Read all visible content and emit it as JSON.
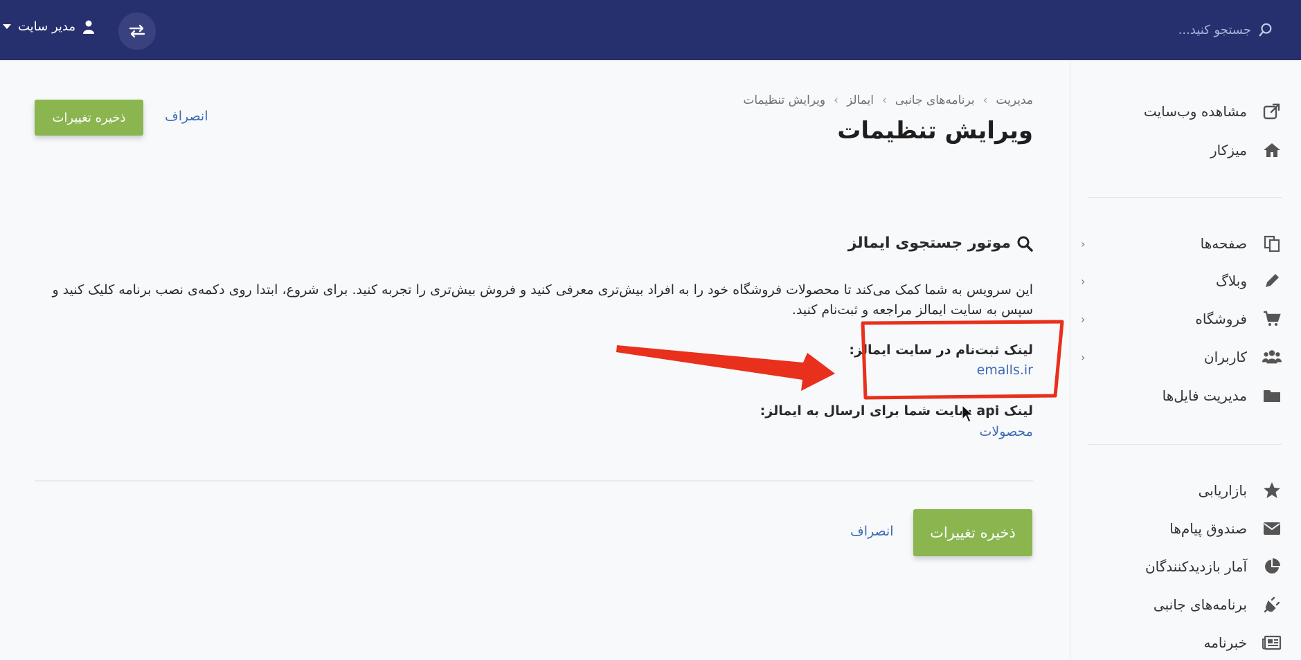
{
  "topbar": {
    "search_placeholder": "جستجو کنید...",
    "user_label": "مدیر سایت"
  },
  "sidebar": {
    "items": [
      {
        "label": "مشاهده وب‌سایت",
        "icon": "external-link-icon"
      },
      {
        "label": "میزکار",
        "icon": "home-icon"
      },
      {
        "label": "صفحه‌ها",
        "icon": "pages-icon"
      },
      {
        "label": "وبلاگ",
        "icon": "pencil-icon"
      },
      {
        "label": "فروشگاه",
        "icon": "cart-icon"
      },
      {
        "label": "کاربران",
        "icon": "users-icon"
      },
      {
        "label": "مدیریت فایل‌ها",
        "icon": "folder-icon"
      },
      {
        "label": "بازاریابی",
        "icon": "star-icon"
      },
      {
        "label": "صندوق پیام‌ها",
        "icon": "envelope-icon"
      },
      {
        "label": "آمار بازدیدکنندگان",
        "icon": "pie-chart-icon"
      },
      {
        "label": "برنامه‌های جانبی",
        "icon": "plug-icon"
      },
      {
        "label": "خبرنامه",
        "icon": "newspaper-icon"
      }
    ]
  },
  "main": {
    "breadcrumb": [
      "مدیریت",
      "برنامه‌های جانبی",
      "ایمالز",
      "ویرایش تنظیمات"
    ],
    "title": "ویرایش تنظیمات",
    "save_label": "ذخیره تغییرات",
    "cancel_label": "انصراف",
    "section_title": "موتور جستجوی ایمالز",
    "description": "این سرویس به شما کمک می‌کند تا محصولات فروشگاه خود را به افراد بیش‌تری معرفی کنید و فروش بیش‌تری را تجربه کنید. برای شروع، ابتدا روی دکمه‌ی نصب برنامه کلیک کنید و سپس به سایت ایمالز مراجعه و ثبت‌نام کنید.",
    "signup_label": "لینک ثبت‌نام در سایت ایمالز:",
    "signup_link": "emalls.ir",
    "api_label": "لینک api سایت شما برای ارسال به ایمالز:",
    "api_link": "محصولات"
  },
  "colors": {
    "topbar": "#27306f",
    "save_button": "#8ab54f",
    "link": "#3c6bb4",
    "annotation": "#e8301c"
  }
}
